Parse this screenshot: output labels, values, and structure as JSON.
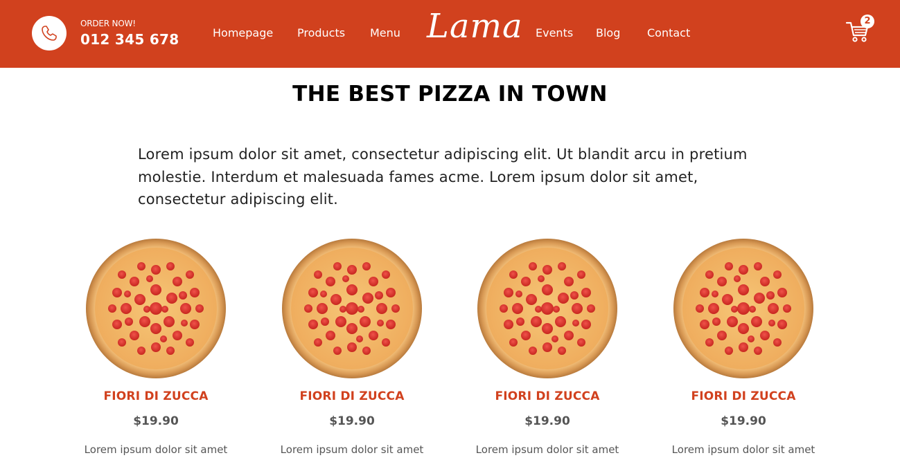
{
  "header": {
    "order_label": "ORDER NOW!",
    "phone": "012 345 678",
    "logo": "Lama",
    "nav_left": [
      "Homepage",
      "Products",
      "Menu"
    ],
    "nav_right": [
      "Events",
      "Blog",
      "Contact"
    ],
    "cart_count": "2",
    "accent_color": "#d1411e"
  },
  "main": {
    "title": "THE BEST PIZZA IN TOWN",
    "intro": "Lorem ipsum dolor sit amet, consectetur adipiscing elit. Ut blandit arcu in pretium molestie. Interdum et malesuada fames acme. Lorem ipsum dolor sit amet, consectetur adipiscing elit.",
    "products": [
      {
        "name": "FIORI DI ZUCCA",
        "price": "$19.90",
        "desc": "Lorem ipsum dolor sit amet consectetur adipiscing elit."
      },
      {
        "name": "FIORI DI ZUCCA",
        "price": "$19.90",
        "desc": "Lorem ipsum dolor sit amet consectetur adipiscing elit."
      },
      {
        "name": "FIORI DI ZUCCA",
        "price": "$19.90",
        "desc": "Lorem ipsum dolor sit amet consectetur adipiscing elit."
      },
      {
        "name": "FIORI DI ZUCCA",
        "price": "$19.90",
        "desc": "Lorem ipsum dolor sit amet consectetur adipiscing elit."
      }
    ]
  },
  "icons": {
    "phone": "phone-icon",
    "cart": "cart-icon",
    "pizza": "pizza-image"
  }
}
